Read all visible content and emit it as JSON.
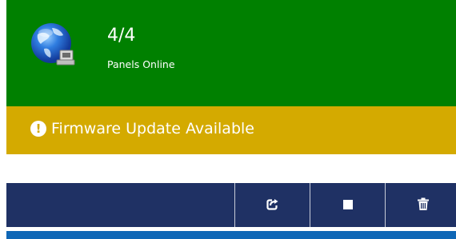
{
  "status": {
    "count": "4/4",
    "label": "Panels Online",
    "icon": "globe-network-icon",
    "color": "#008000"
  },
  "alert": {
    "icon": "exclamation-circle-icon",
    "text": "Firmware Update Available",
    "color": "#d4aa00"
  },
  "toolbar": {
    "color": "#1f3164",
    "buttons": [
      {
        "icon": "share-export-icon"
      },
      {
        "icon": "stop-icon"
      },
      {
        "icon": "trash-icon"
      }
    ]
  },
  "bottom_bar": {
    "color": "#0f67b6"
  }
}
